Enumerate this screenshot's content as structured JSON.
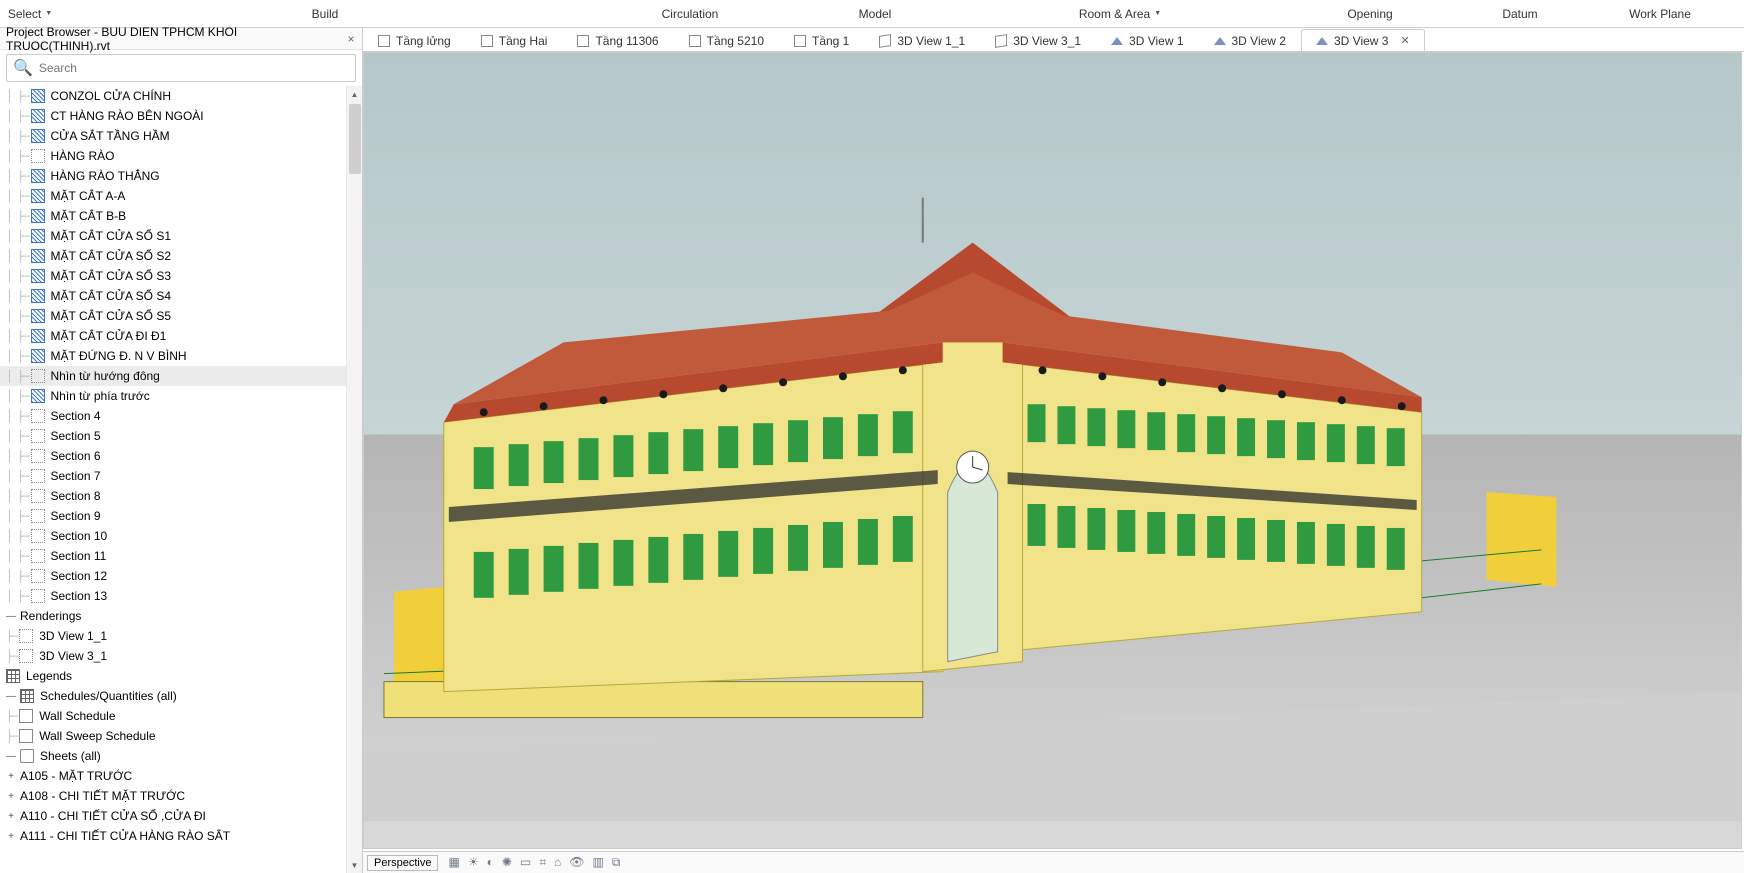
{
  "ribbon": {
    "select": "Select",
    "build": "Build",
    "circulation": "Circulation",
    "model": "Model",
    "room_area": "Room & Area",
    "opening": "Opening",
    "datum": "Datum",
    "work_plane": "Work Plane"
  },
  "sidebar": {
    "title": "Project Browser - BUU DIEN TPHCM KHOI TRUOC(THINH).rvt",
    "search_placeholder": "Search",
    "items": [
      {
        "icon": "blue",
        "label": "CONZOL CỬA CHÍNH"
      },
      {
        "icon": "blue",
        "label": "CT HÀNG RÀO BÊN NGOÀI"
      },
      {
        "icon": "blue",
        "label": "CỬA SẮT TẦNG HẦM"
      },
      {
        "icon": "box",
        "label": "HÀNG RÀO"
      },
      {
        "icon": "blue",
        "label": "HÀNG RÀO THẲNG"
      },
      {
        "icon": "blue",
        "label": "MẶT CẮT A-A"
      },
      {
        "icon": "blue",
        "label": "MẶT CẮT B-B"
      },
      {
        "icon": "blue",
        "label": "MẶT CẮT CỬA SỔ S1"
      },
      {
        "icon": "blue",
        "label": "MẶT CẮT CỬA SỔ S2"
      },
      {
        "icon": "blue",
        "label": "MẶT CẮT CỬA SỔ S3"
      },
      {
        "icon": "blue",
        "label": "MẶT CẮT CỬA SỔ S4"
      },
      {
        "icon": "blue",
        "label": "MẶT CẮT CỬA SỔ S5"
      },
      {
        "icon": "blue",
        "label": "MẶT CẮT CỬA ĐI Đ1"
      },
      {
        "icon": "blue",
        "label": "MẶT ĐỨNG Đ. N V BÌNH"
      },
      {
        "icon": "box",
        "label": "Nhìn từ hướng đông",
        "selected": true
      },
      {
        "icon": "blue",
        "label": "Nhìn từ phía trước"
      },
      {
        "icon": "box",
        "label": "Section 4"
      },
      {
        "icon": "box",
        "label": "Section 5"
      },
      {
        "icon": "box",
        "label": "Section 6"
      },
      {
        "icon": "box",
        "label": "Section 7"
      },
      {
        "icon": "box",
        "label": "Section 8"
      },
      {
        "icon": "box",
        "label": "Section 9"
      },
      {
        "icon": "box",
        "label": "Section 10"
      },
      {
        "icon": "box",
        "label": "Section 11"
      },
      {
        "icon": "box",
        "label": "Section 12"
      },
      {
        "icon": "box",
        "label": "Section 13"
      }
    ],
    "renderings": {
      "label": "Renderings",
      "children": [
        {
          "label": "3D View 1_1"
        },
        {
          "label": "3D View 3_1"
        }
      ]
    },
    "legends": "Legends",
    "schedules": {
      "label": "Schedules/Quantities (all)",
      "children": [
        {
          "label": "Wall Schedule"
        },
        {
          "label": "Wall Sweep Schedule"
        }
      ]
    },
    "sheets": {
      "label": "Sheets (all)",
      "children": [
        {
          "label": "A105 - MẶT TRƯỚC"
        },
        {
          "label": "A108 - CHI TIẾT MẶT TRƯỚC"
        },
        {
          "label": "A110 - CHI TIẾT CỬA SỔ ,CỬA ĐI"
        },
        {
          "label": "A111 - CHI TIẾT CỬA HÀNG RÀO SẮT"
        }
      ]
    }
  },
  "tabs": [
    {
      "icon": "plan",
      "label": "Tầng lửng"
    },
    {
      "icon": "plan",
      "label": "Tầng Hai"
    },
    {
      "icon": "plan",
      "label": "Tầng 11306"
    },
    {
      "icon": "plan",
      "label": "Tầng 5210"
    },
    {
      "icon": "plan",
      "label": "Tầng 1"
    },
    {
      "icon": "cube",
      "label": "3D View 1_1"
    },
    {
      "icon": "cube",
      "label": "3D View 3_1"
    },
    {
      "icon": "home",
      "label": "3D View 1"
    },
    {
      "icon": "home",
      "label": "3D View 2"
    },
    {
      "icon": "home",
      "label": "3D View 3",
      "active": true
    }
  ],
  "status": {
    "mode": "Perspective"
  }
}
